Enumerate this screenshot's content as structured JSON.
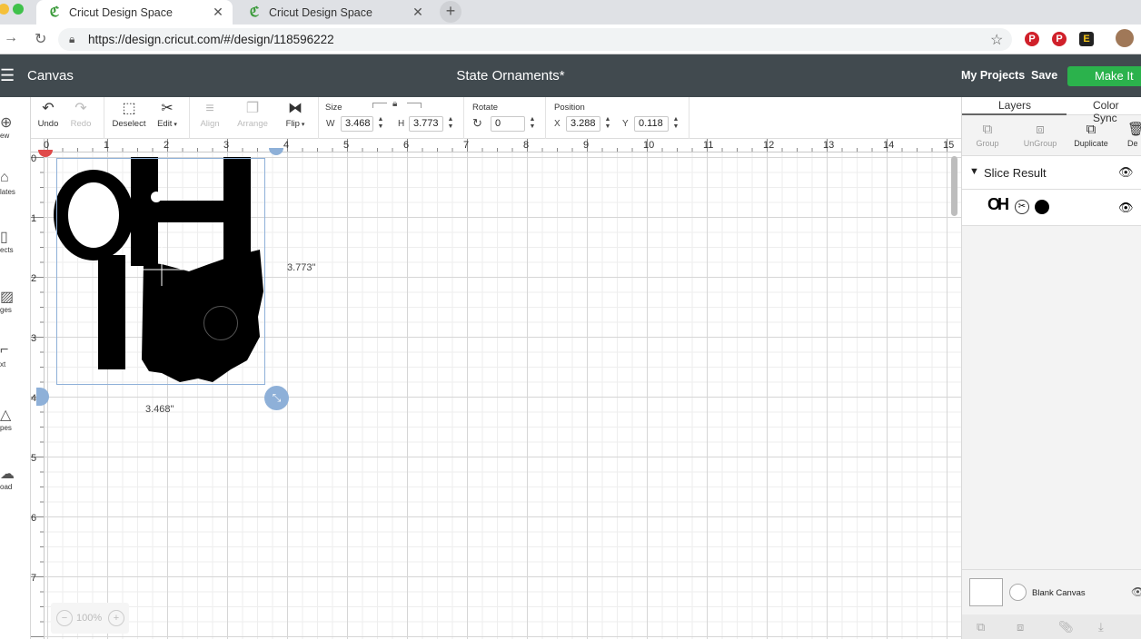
{
  "browser": {
    "tabs": [
      {
        "title": "Cricut Design Space",
        "active": true
      },
      {
        "title": "Cricut Design Space",
        "active": false
      }
    ],
    "url": "https://design.cricut.com/#/design/118596222"
  },
  "header": {
    "menu_label": "Canvas",
    "document_title": "State Ornaments*",
    "my_projects": "My Projects",
    "save": "Save",
    "make_it": "Make It"
  },
  "toolbar": {
    "undo": "Undo",
    "redo": "Redo",
    "deselect": "Deselect",
    "edit": "Edit",
    "align": "Align",
    "arrange": "Arrange",
    "flip": "Flip",
    "size_label": "Size",
    "w_label": "W",
    "w_value": "3.468",
    "h_label": "H",
    "h_value": "3.773",
    "rotate_label": "Rotate",
    "rotate_value": "0",
    "position_label": "Position",
    "x_label": "X",
    "x_value": "3.288",
    "y_label": "Y",
    "y_value": "0.118"
  },
  "left_sidebar": {
    "items": [
      "ew",
      "lates",
      "ects",
      "ges",
      "xt",
      "pes",
      "oad"
    ]
  },
  "canvas": {
    "ruler_top": [
      "0",
      "1",
      "2",
      "3",
      "4",
      "5",
      "6",
      "7",
      "8",
      "9",
      "10",
      "11",
      "12",
      "13",
      "14",
      "15"
    ],
    "ruler_left": [
      "0",
      "1",
      "2",
      "3",
      "4",
      "5",
      "6",
      "7"
    ],
    "height_readout": "3.773\"",
    "width_readout": "3.468\"",
    "zoom": "100%"
  },
  "right_panel": {
    "tabs": [
      "Layers",
      "Color Sync"
    ],
    "tools": [
      "Group",
      "UnGroup",
      "Duplicate",
      "De"
    ],
    "layer_group": "Slice Result",
    "blank_canvas": "Blank Canvas"
  },
  "colors": {
    "header_bg": "#414a4f",
    "make_it": "#2bb24c",
    "grid_line": "#e2e2e2",
    "selection": "#8eb0d8"
  }
}
